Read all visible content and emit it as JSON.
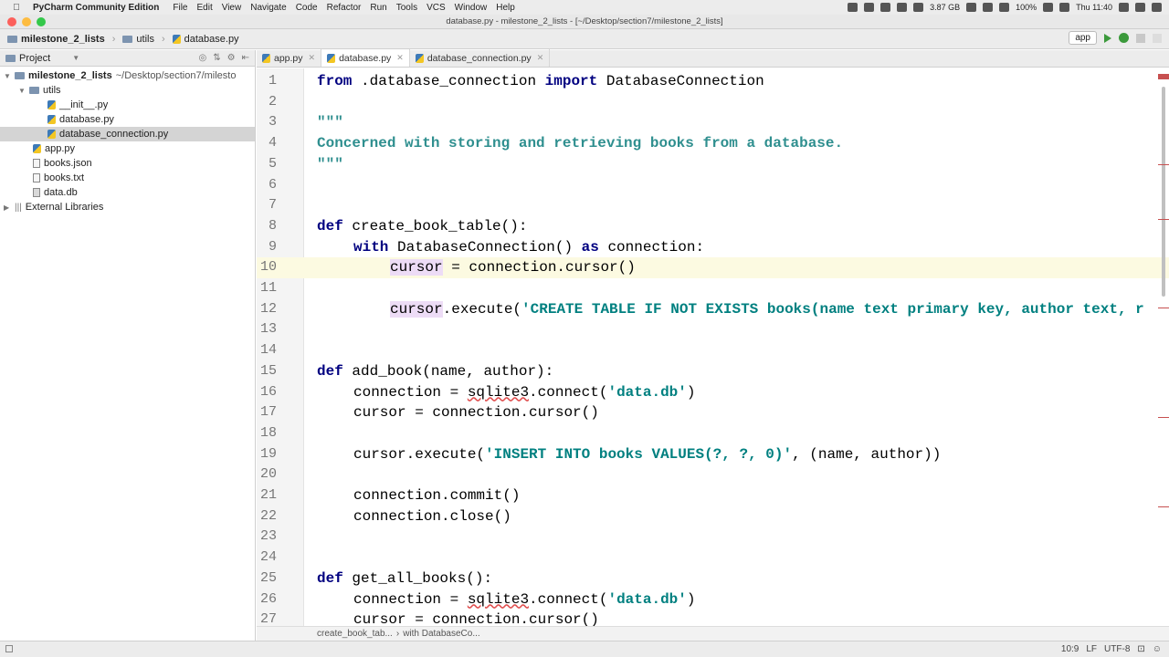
{
  "menubar": {
    "app_name": "PyCharm Community Edition",
    "items": [
      "File",
      "Edit",
      "View",
      "Navigate",
      "Code",
      "Refactor",
      "Run",
      "Tools",
      "VCS",
      "Window",
      "Help"
    ],
    "memory": "3.87 GB",
    "battery": "100%",
    "clock": "Thu 11:40"
  },
  "window": {
    "title": "database.py - milestone_2_lists - [~/Desktop/section7/milestone_2_lists]"
  },
  "navbar": {
    "crumbs": [
      "milestone_2_lists",
      "utils",
      "database.py"
    ],
    "run_config": "app"
  },
  "sidebar": {
    "title": "Project",
    "root": "milestone_2_lists",
    "root_path": "~/Desktop/section7/milesto",
    "folder": "utils",
    "utils_files": [
      "__init__.py",
      "database.py",
      "database_connection.py"
    ],
    "root_files": [
      "app.py",
      "books.json",
      "books.txt",
      "data.db"
    ],
    "external": "External Libraries"
  },
  "tabs": [
    "app.py",
    "database.py",
    "database_connection.py"
  ],
  "editor": {
    "line_numbers": [
      "1",
      "2",
      "3",
      "4",
      "5",
      "6",
      "7",
      "8",
      "9",
      "10",
      "11",
      "12",
      "13",
      "14",
      "15",
      "16",
      "17",
      "18",
      "19",
      "20",
      "21",
      "22",
      "23",
      "24",
      "25",
      "26",
      "27"
    ],
    "l1": {
      "kw1": "from",
      "mod": " .database_connection ",
      "kw2": "import",
      "name": " DatabaseConnection"
    },
    "l3": "\"\"\"",
    "l4": "Concerned with storing and retrieving books from a database.",
    "l5": "\"\"\"",
    "l8": {
      "kw": "def",
      "rest": " create_book_table():"
    },
    "l9": {
      "kw": "with",
      "mid": " DatabaseConnection() ",
      "kw2": "as",
      "rest": " connection:"
    },
    "l10": {
      "var": "cursor",
      "rest": " = connection.cursor()"
    },
    "l12": {
      "var": "cursor",
      "call": ".execute(",
      "str": "'CREATE TABLE IF NOT EXISTS books(name text primary key, author text, r"
    },
    "l15": {
      "kw": "def",
      "rest": " add_book(name, author):"
    },
    "l16": {
      "pre": "connection = ",
      "mod": "sqlite3",
      "mid": ".connect(",
      "str": "'data.db'",
      "post": ")"
    },
    "l17": "cursor = connection.cursor()",
    "l19": {
      "pre": "cursor.execute(",
      "str": "'INSERT INTO books VALUES(?, ?, 0)'",
      "post": ", (name, author))"
    },
    "l21": "connection.commit()",
    "l22": "connection.close()",
    "l25": {
      "kw": "def",
      "rest": " get_all_books():"
    },
    "l26": {
      "pre": "connection = ",
      "mod": "sqlite3",
      "mid": ".connect(",
      "str": "'data.db'",
      "post": ")"
    },
    "l27": "cursor = connection.cursor()"
  },
  "breadcrumb_bottom": [
    "create_book_tab...",
    "with DatabaseCo..."
  ],
  "status": {
    "position": "10:9",
    "line_sep": "LF",
    "encoding": "UTF-8"
  }
}
